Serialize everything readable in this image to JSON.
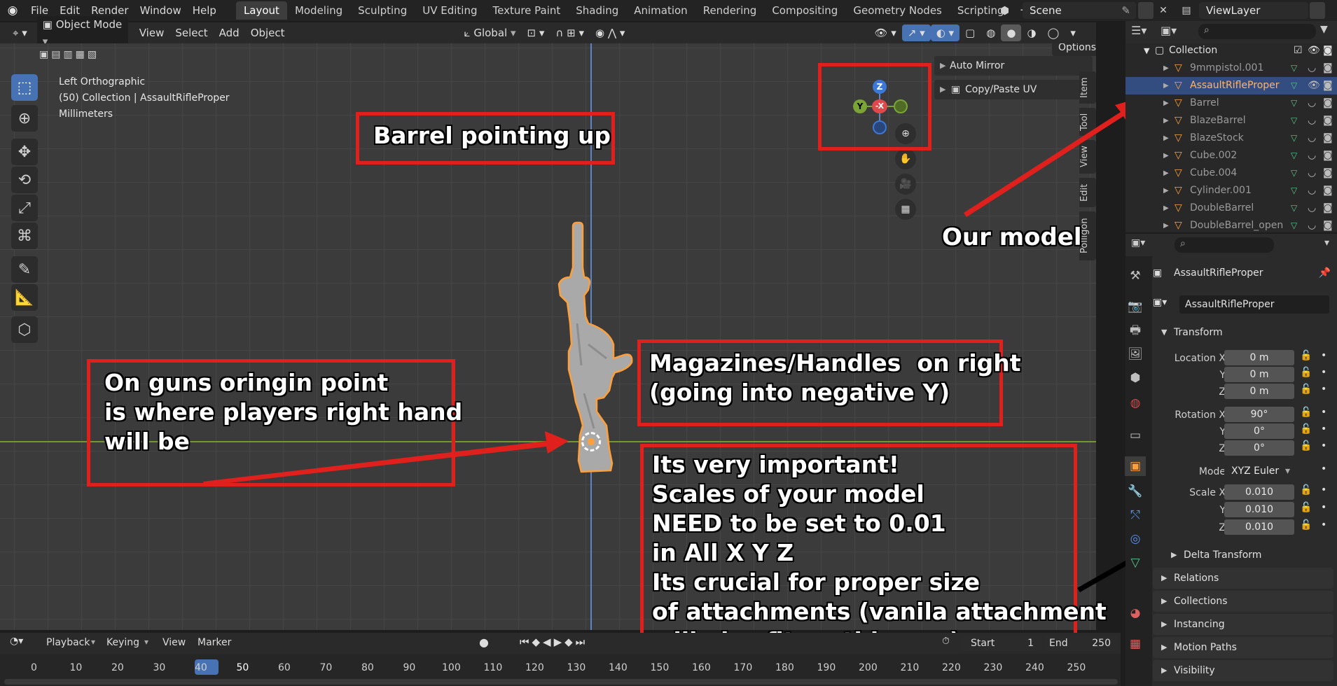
{
  "topbar": {
    "menus": [
      "File",
      "Edit",
      "Render",
      "Window",
      "Help"
    ],
    "workspaces": [
      "Layout",
      "Modeling",
      "Sculpting",
      "UV Editing",
      "Texture Paint",
      "Shading",
      "Animation",
      "Rendering",
      "Compositing",
      "Geometry Nodes",
      "Scripting"
    ],
    "add_tab": "+",
    "scene": "Scene",
    "view_layer": "ViewLayer"
  },
  "viewport_header": {
    "mode": "Object Mode",
    "menus": [
      "View",
      "Select",
      "Add",
      "Object"
    ],
    "transform_orientation": "Global",
    "options": "Options"
  },
  "viewport": {
    "view_name": "Left Orthographic",
    "collection_info": "(50) Collection | AssaultRifleProper",
    "units": "Millimeters",
    "gizmo": {
      "z": "Z",
      "y": "Y",
      "x": "-X"
    },
    "side_tabs": [
      "Item",
      "Tool",
      "View",
      "Edit",
      "Polligon"
    ],
    "panels": [
      "Auto Mirror",
      "Copy/Paste UV"
    ]
  },
  "annotations": {
    "barrel": "Barrel pointing up",
    "origin": [
      "On guns oringin point",
      "is where players right hand",
      "will be"
    ],
    "magazines": [
      "Magazines/Handles  on right",
      "(going into negative Y)"
    ],
    "important": [
      "Its very important!",
      "Scales of your model",
      "NEED to be set to 0.01",
      "in All X Y Z",
      "Its crucial for proper size",
      "of attachments (vanila attachment",
      "will also fit on this gun)"
    ],
    "model": "Our model"
  },
  "outliner": {
    "collection": "Collection",
    "items": [
      "9mmpistol.001",
      "AssaultRifleProper",
      "Barrel",
      "BlazeBarrel",
      "BlazeStock",
      "Cube.002",
      "Cube.004",
      "Cylinder.001",
      "DoubleBarrel",
      "DoubleBarrel_open"
    ]
  },
  "properties": {
    "object_name": "AssaultRifleProper",
    "data_name": "AssaultRifleProper",
    "transform_title": "Transform",
    "location": {
      "label_x": "Location X",
      "x": "0 m",
      "y": "0 m",
      "z": "0 m"
    },
    "rotation": {
      "label_x": "Rotation X",
      "x": "90°",
      "y": "0°",
      "z": "0°"
    },
    "mode_label": "Mode",
    "mode_value": "XYZ Euler",
    "scale": {
      "label_x": "Scale X",
      "x": "0.010",
      "y": "0.010",
      "z": "0.010"
    },
    "axis_y": "Y",
    "axis_z": "Z",
    "sections": [
      "Delta Transform",
      "Relations",
      "Collections",
      "Instancing",
      "Motion Paths",
      "Visibility"
    ]
  },
  "timeline": {
    "menus": [
      "Playback",
      "Keying",
      "View",
      "Marker"
    ],
    "current_frame": "50",
    "start_label": "Start",
    "start": "1",
    "end_label": "End",
    "end": "250",
    "frames": [
      "0",
      "10",
      "20",
      "30",
      "40",
      "50",
      "60",
      "70",
      "80",
      "90",
      "100",
      "110",
      "120",
      "130",
      "140",
      "150",
      "160",
      "170",
      "180",
      "190",
      "200",
      "210",
      "220",
      "230",
      "240",
      "250"
    ]
  },
  "colors": {
    "accent": "#4772b3",
    "annotation": "#e0201c",
    "selection_orange": "#ff9f3a"
  }
}
